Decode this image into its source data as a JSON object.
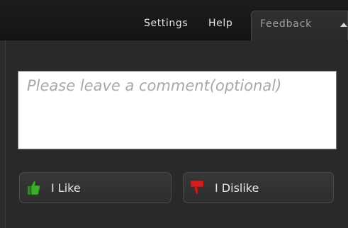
{
  "menu": {
    "settings": "Settings",
    "help": "Help",
    "feedback_tab": "Feedback"
  },
  "comment": {
    "placeholder": "Please leave a comment(optional)",
    "value": ""
  },
  "buttons": {
    "like_label": "I Like",
    "dislike_label": "I Dislike"
  },
  "icons": {
    "like": "thumbs-up-icon",
    "dislike": "thumbs-down-icon",
    "collapse": "triangle-up-icon"
  },
  "colors": {
    "like_icon": "#3cae2c",
    "dislike_icon": "#d11f1f"
  }
}
